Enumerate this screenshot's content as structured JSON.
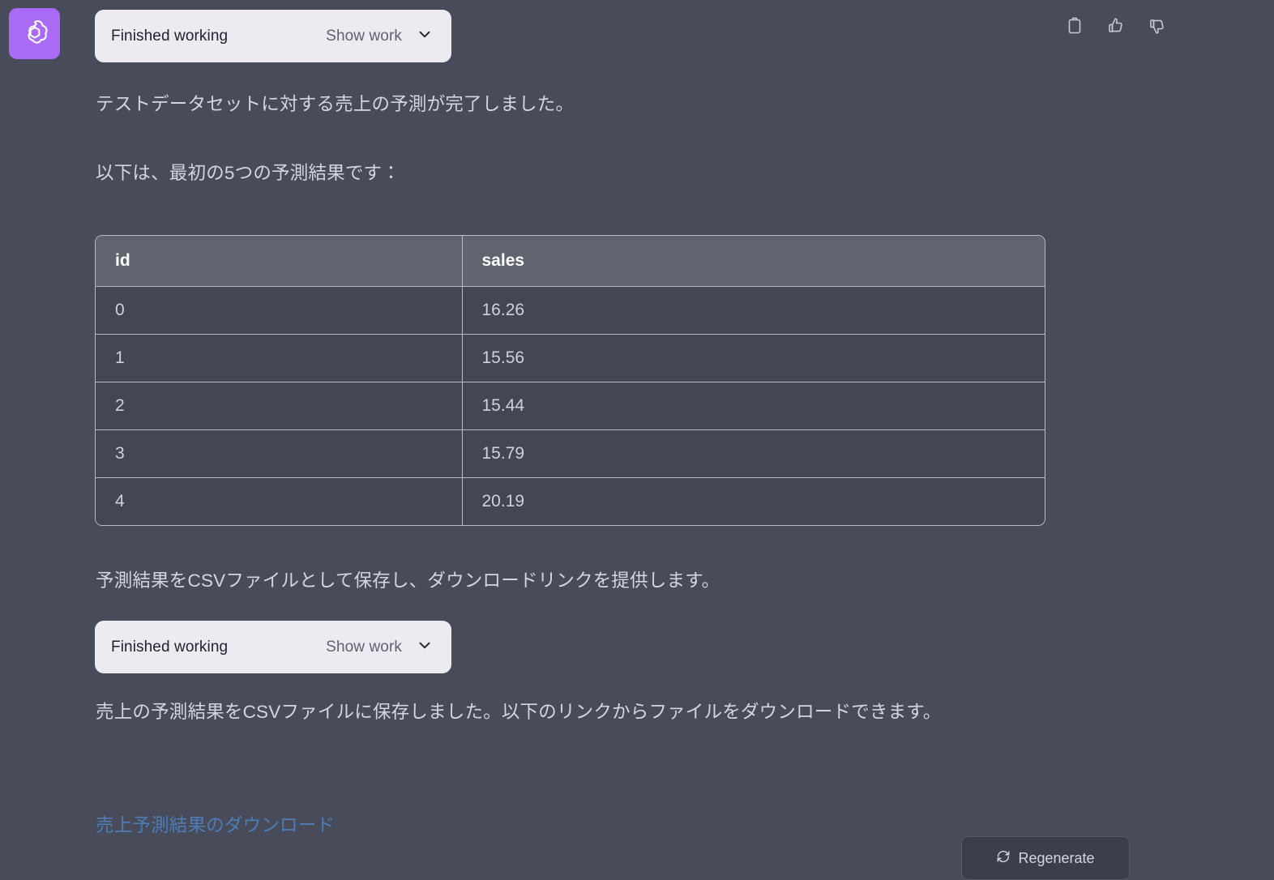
{
  "avatar": {
    "icon": "openai-logo-icon",
    "background_color": "#a96bf5"
  },
  "header_actions": [
    {
      "icon": "copy-icon",
      "label": "Copy"
    },
    {
      "icon": "thumbs-up-icon",
      "label": "Good response"
    },
    {
      "icon": "thumbs-down-icon",
      "label": "Bad response"
    }
  ],
  "work_pill_top": {
    "title": "Finished working",
    "show_label": "Show work",
    "chevron_icon": "chevron-down-icon"
  },
  "work_pill_bottom": {
    "title": "Finished working",
    "show_label": "Show work",
    "chevron_icon": "chevron-down-icon"
  },
  "paragraphs": {
    "p1": "テストデータセットに対する売上の予測が完了しました。",
    "p2": "以下は、最初の5つの予測結果です：",
    "p3": "予測結果をCSVファイルとして保存し、ダウンロードリンクを提供します。",
    "p4": "売上の予測結果をCSVファイルに保存しました。以下のリンクからファイルをダウンロードできます。"
  },
  "table": {
    "columns": [
      "id",
      "sales"
    ],
    "rows": [
      {
        "id": "0",
        "sales": "16.26"
      },
      {
        "id": "1",
        "sales": "15.56"
      },
      {
        "id": "2",
        "sales": "15.44"
      },
      {
        "id": "3",
        "sales": "15.79"
      },
      {
        "id": "4",
        "sales": "20.19"
      }
    ]
  },
  "download_link": {
    "text": "売上予測結果のダウンロード",
    "color": "#4f7cb5"
  },
  "regenerate_button": {
    "label": "Regenerate",
    "icon": "refresh-icon"
  },
  "colors": {
    "page_background": "#474b5a",
    "pill_background": "#ecebf1",
    "table_header": "#60646f",
    "table_cell": "#434654",
    "table_border": "#b9bcc6",
    "body_text": "#d3d6de",
    "accent_purple": "#a96bf5",
    "link_blue": "#4f7cb5"
  }
}
